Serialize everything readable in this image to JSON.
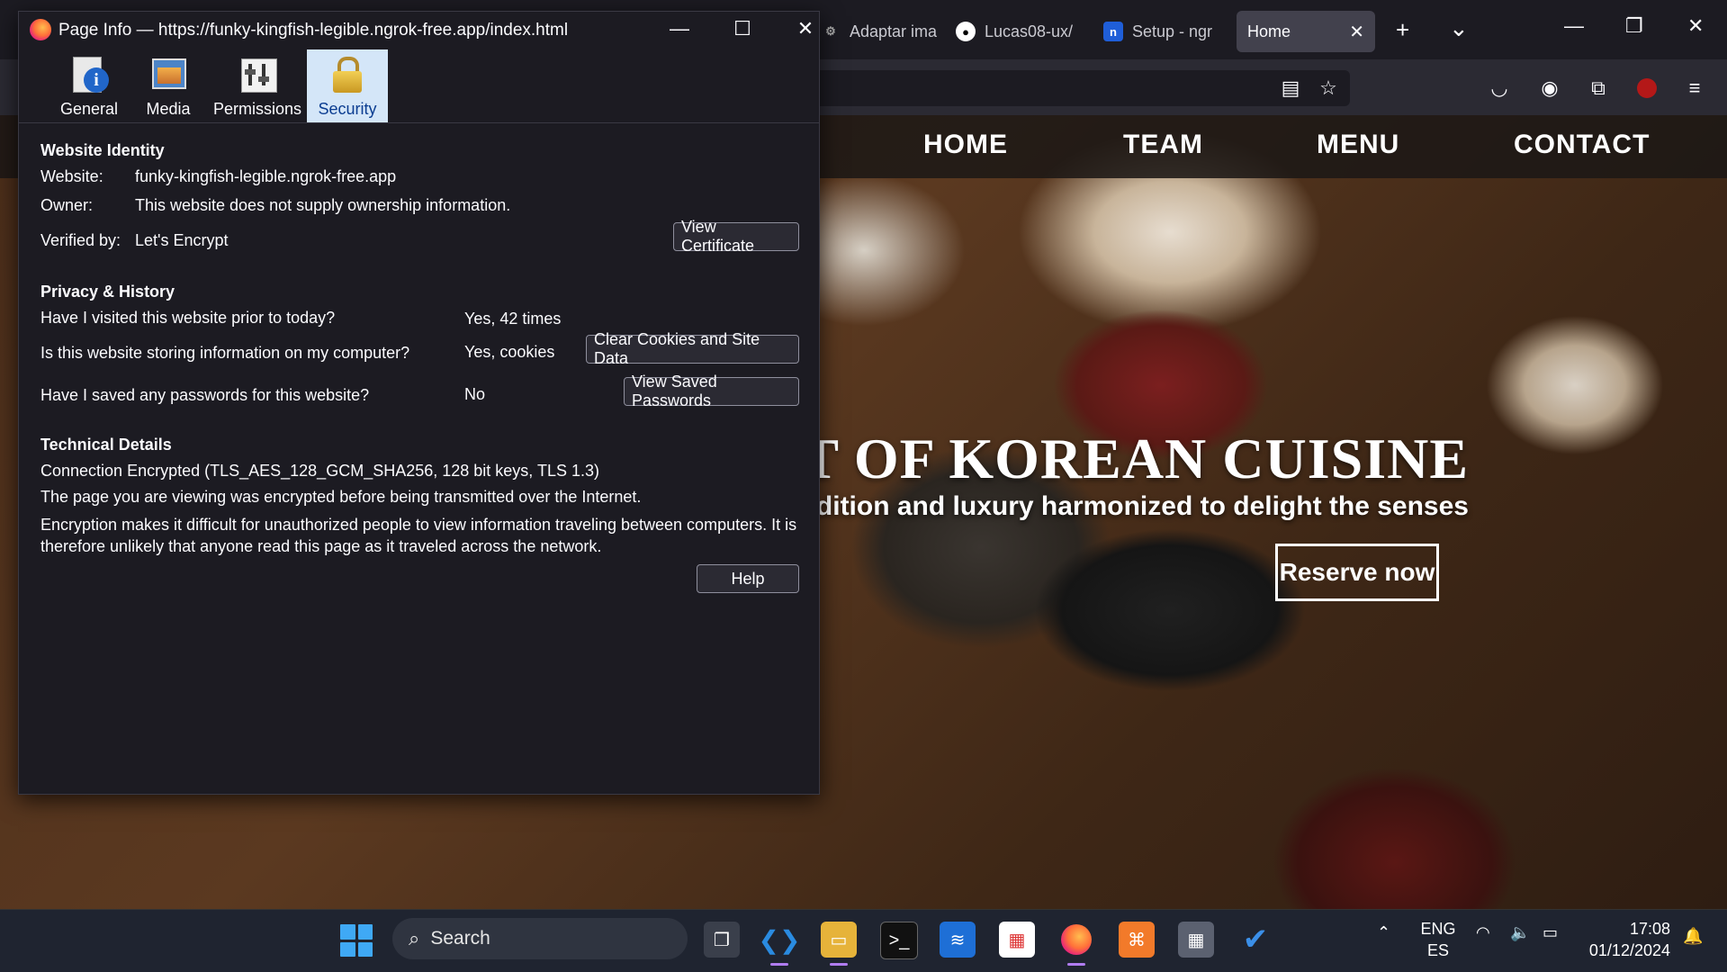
{
  "browser": {
    "tabs": [
      {
        "label": "Adaptar ima",
        "icon": "gear-icon"
      },
      {
        "label": "Lucas08-ux/",
        "icon": "github-icon"
      },
      {
        "label": "Setup - ngr",
        "icon": "ngrok-icon"
      }
    ],
    "active_tab": {
      "label": "Home"
    },
    "new_tab_symbol": "+",
    "list_tabs_symbol": "⌄"
  },
  "website": {
    "nav": [
      "HOME",
      "TEAM",
      "MENU",
      "CONTACT"
    ],
    "hero_title": "HE ART OF KOREAN CUISINE",
    "hero_subtitle": "adition and luxury harmonized to delight the senses",
    "reserve_label": "Reserve now"
  },
  "dialog": {
    "title": "Page Info — https://funky-kingfish-legible.ngrok-free.app/index.html",
    "tabs": [
      "General",
      "Media",
      "Permissions",
      "Security"
    ],
    "selected_tab": "Security",
    "identity": {
      "heading": "Website Identity",
      "website_label": "Website:",
      "website_value": "funky-kingfish-legible.ngrok-free.app",
      "owner_label": "Owner:",
      "owner_value": "This website does not supply ownership information.",
      "verified_label": "Verified by:",
      "verified_value": "Let's Encrypt",
      "view_cert_label": "View Certificate"
    },
    "privacy": {
      "heading": "Privacy & History",
      "q1": "Have I visited this website prior to today?",
      "a1": "Yes, 42 times",
      "q2": "Is this website storing information on my computer?",
      "a2": "Yes, cookies",
      "clear_label": "Clear Cookies and Site Data",
      "q3": "Have I saved any passwords for this website?",
      "a3": "No",
      "view_passwords_label": "View Saved Passwords"
    },
    "technical": {
      "heading": "Technical Details",
      "line1": "Connection Encrypted (TLS_AES_128_GCM_SHA256, 128 bit keys, TLS 1.3)",
      "line2": "The page you are viewing was encrypted before being transmitted over the Internet.",
      "line3": "Encryption makes it difficult for unauthorized people to view information traveling between computers. It is therefore unlikely that anyone read this page as it traveled across the network.",
      "help_label": "Help"
    }
  },
  "taskbar": {
    "search_placeholder": "Search",
    "lang_top": "ENG",
    "lang_bottom": "ES",
    "time": "17:08",
    "date": "01/12/2024"
  },
  "colors": {
    "selected_tab_bg": "#d4e6f8",
    "accent_windows": "#3fa9f5",
    "active_indicator": "#b07cf0"
  }
}
